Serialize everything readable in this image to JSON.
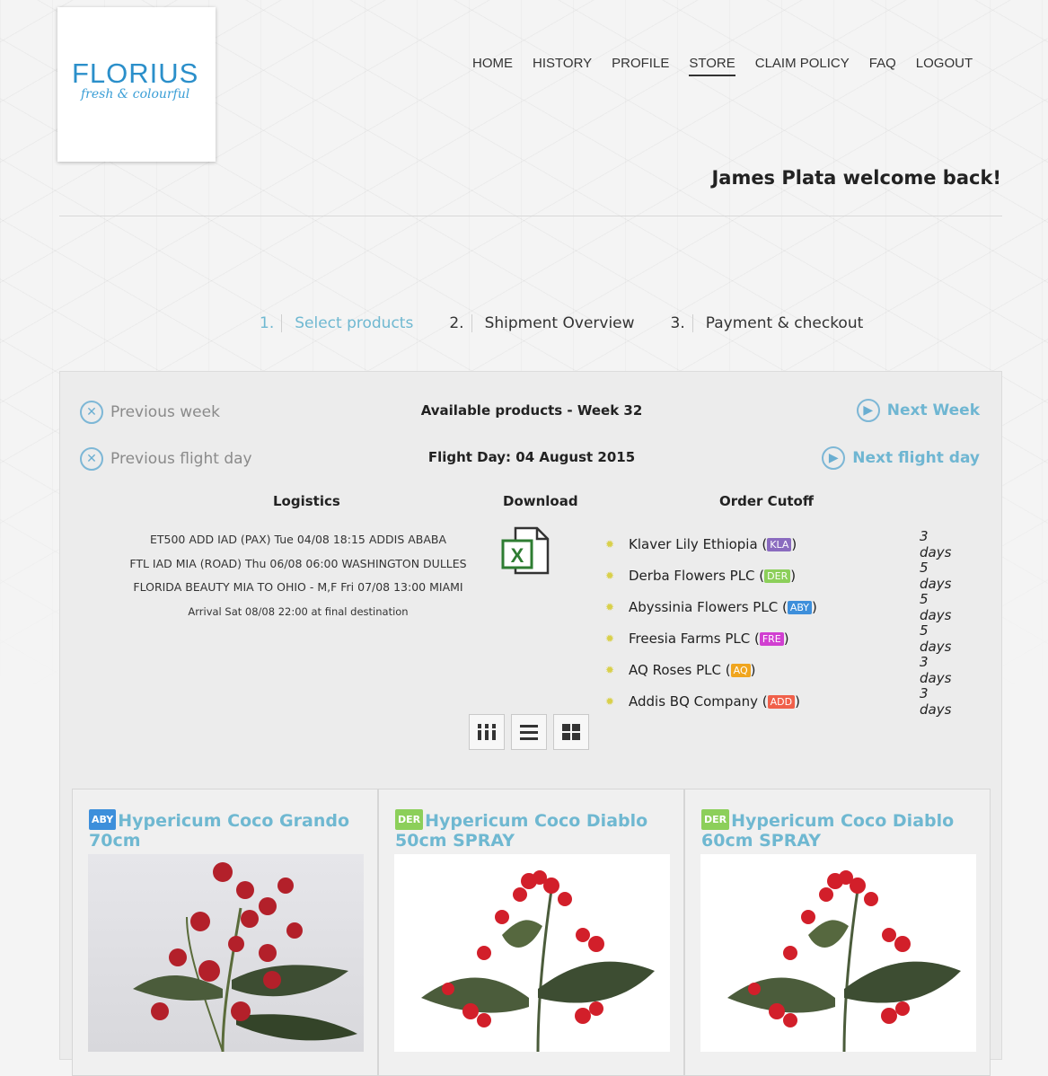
{
  "brand": {
    "name": "FLORIUS",
    "tagline": "fresh & colourful"
  },
  "nav": [
    {
      "label": "HOME",
      "active": false
    },
    {
      "label": "HISTORY",
      "active": false
    },
    {
      "label": "PROFILE",
      "active": false
    },
    {
      "label": "STORE",
      "active": true
    },
    {
      "label": "CLAIM POLICY",
      "active": false
    },
    {
      "label": "FAQ",
      "active": false
    },
    {
      "label": "LOGOUT",
      "active": false
    }
  ],
  "welcome": "James Plata welcome back!",
  "steps": [
    {
      "num": "1.",
      "label": "Select products",
      "active": true
    },
    {
      "num": "2.",
      "label": "Shipment Overview",
      "active": false
    },
    {
      "num": "3.",
      "label": "Payment & checkout",
      "active": false
    }
  ],
  "panel": {
    "previous_week": "Previous week",
    "previous_flight_day": "Previous flight day",
    "title": "Available products - Week 32",
    "flight_day": "Flight Day: 04 August 2015",
    "next_week": "Next Week",
    "next_flight_day": "Next flight day",
    "logistics_heading": "Logistics",
    "download_heading": "Download",
    "cutoff_heading": "Order Cutoff",
    "logistics": [
      "ET500 ADD IAD (PAX) Tue 04/08 18:15 ADDIS ABABA",
      "FTL IAD MIA (ROAD) Thu 06/08 06:00 WASHINGTON DULLES",
      "FLORIDA BEAUTY MIA TO OHIO - M,F Fri 07/08 13:00 MIAMI",
      "Arrival Sat 08/08 22:00 at final destination"
    ],
    "cutoffs": [
      {
        "name": "Klaver Lily Ethiopia (",
        "code": "KLA",
        "color": "#8a6bbf",
        "days": "3 days"
      },
      {
        "name": "Derba Flowers PLC (",
        "code": "DER",
        "color": "#8ccf5a",
        "days": "5 days"
      },
      {
        "name": "Abyssinia Flowers PLC (",
        "code": "ABY",
        "color": "#3d8fdb",
        "days": "5 days"
      },
      {
        "name": "Freesia Farms PLC (",
        "code": "FRE",
        "color": "#d13fd1",
        "days": "5 days"
      },
      {
        "name": "AQ Roses PLC (",
        "code": "AQ",
        "color": "#f0a51e",
        "days": "3 days"
      },
      {
        "name": "Addis BQ Company (",
        "code": "ADD",
        "color": "#f0604a",
        "days": "3 days"
      }
    ]
  },
  "products": [
    {
      "code": "ABY",
      "color": "#3d8fdb",
      "title": "Hypericum Coco Grando 70cm"
    },
    {
      "code": "DER",
      "color": "#8ccf5a",
      "title": "Hypericum Coco Diablo 50cm SPRAY"
    },
    {
      "code": "DER",
      "color": "#8ccf5a",
      "title": "Hypericum Coco Diablo 60cm SPRAY"
    }
  ],
  "icons": {
    "prev": "circle-x-icon",
    "next": "circle-play-icon",
    "excel": "excel-icon",
    "bullet": "star-bullet-icon",
    "view_columns": "columns-view-icon",
    "view_list": "list-view-icon",
    "view_grid": "grid-view-icon"
  }
}
